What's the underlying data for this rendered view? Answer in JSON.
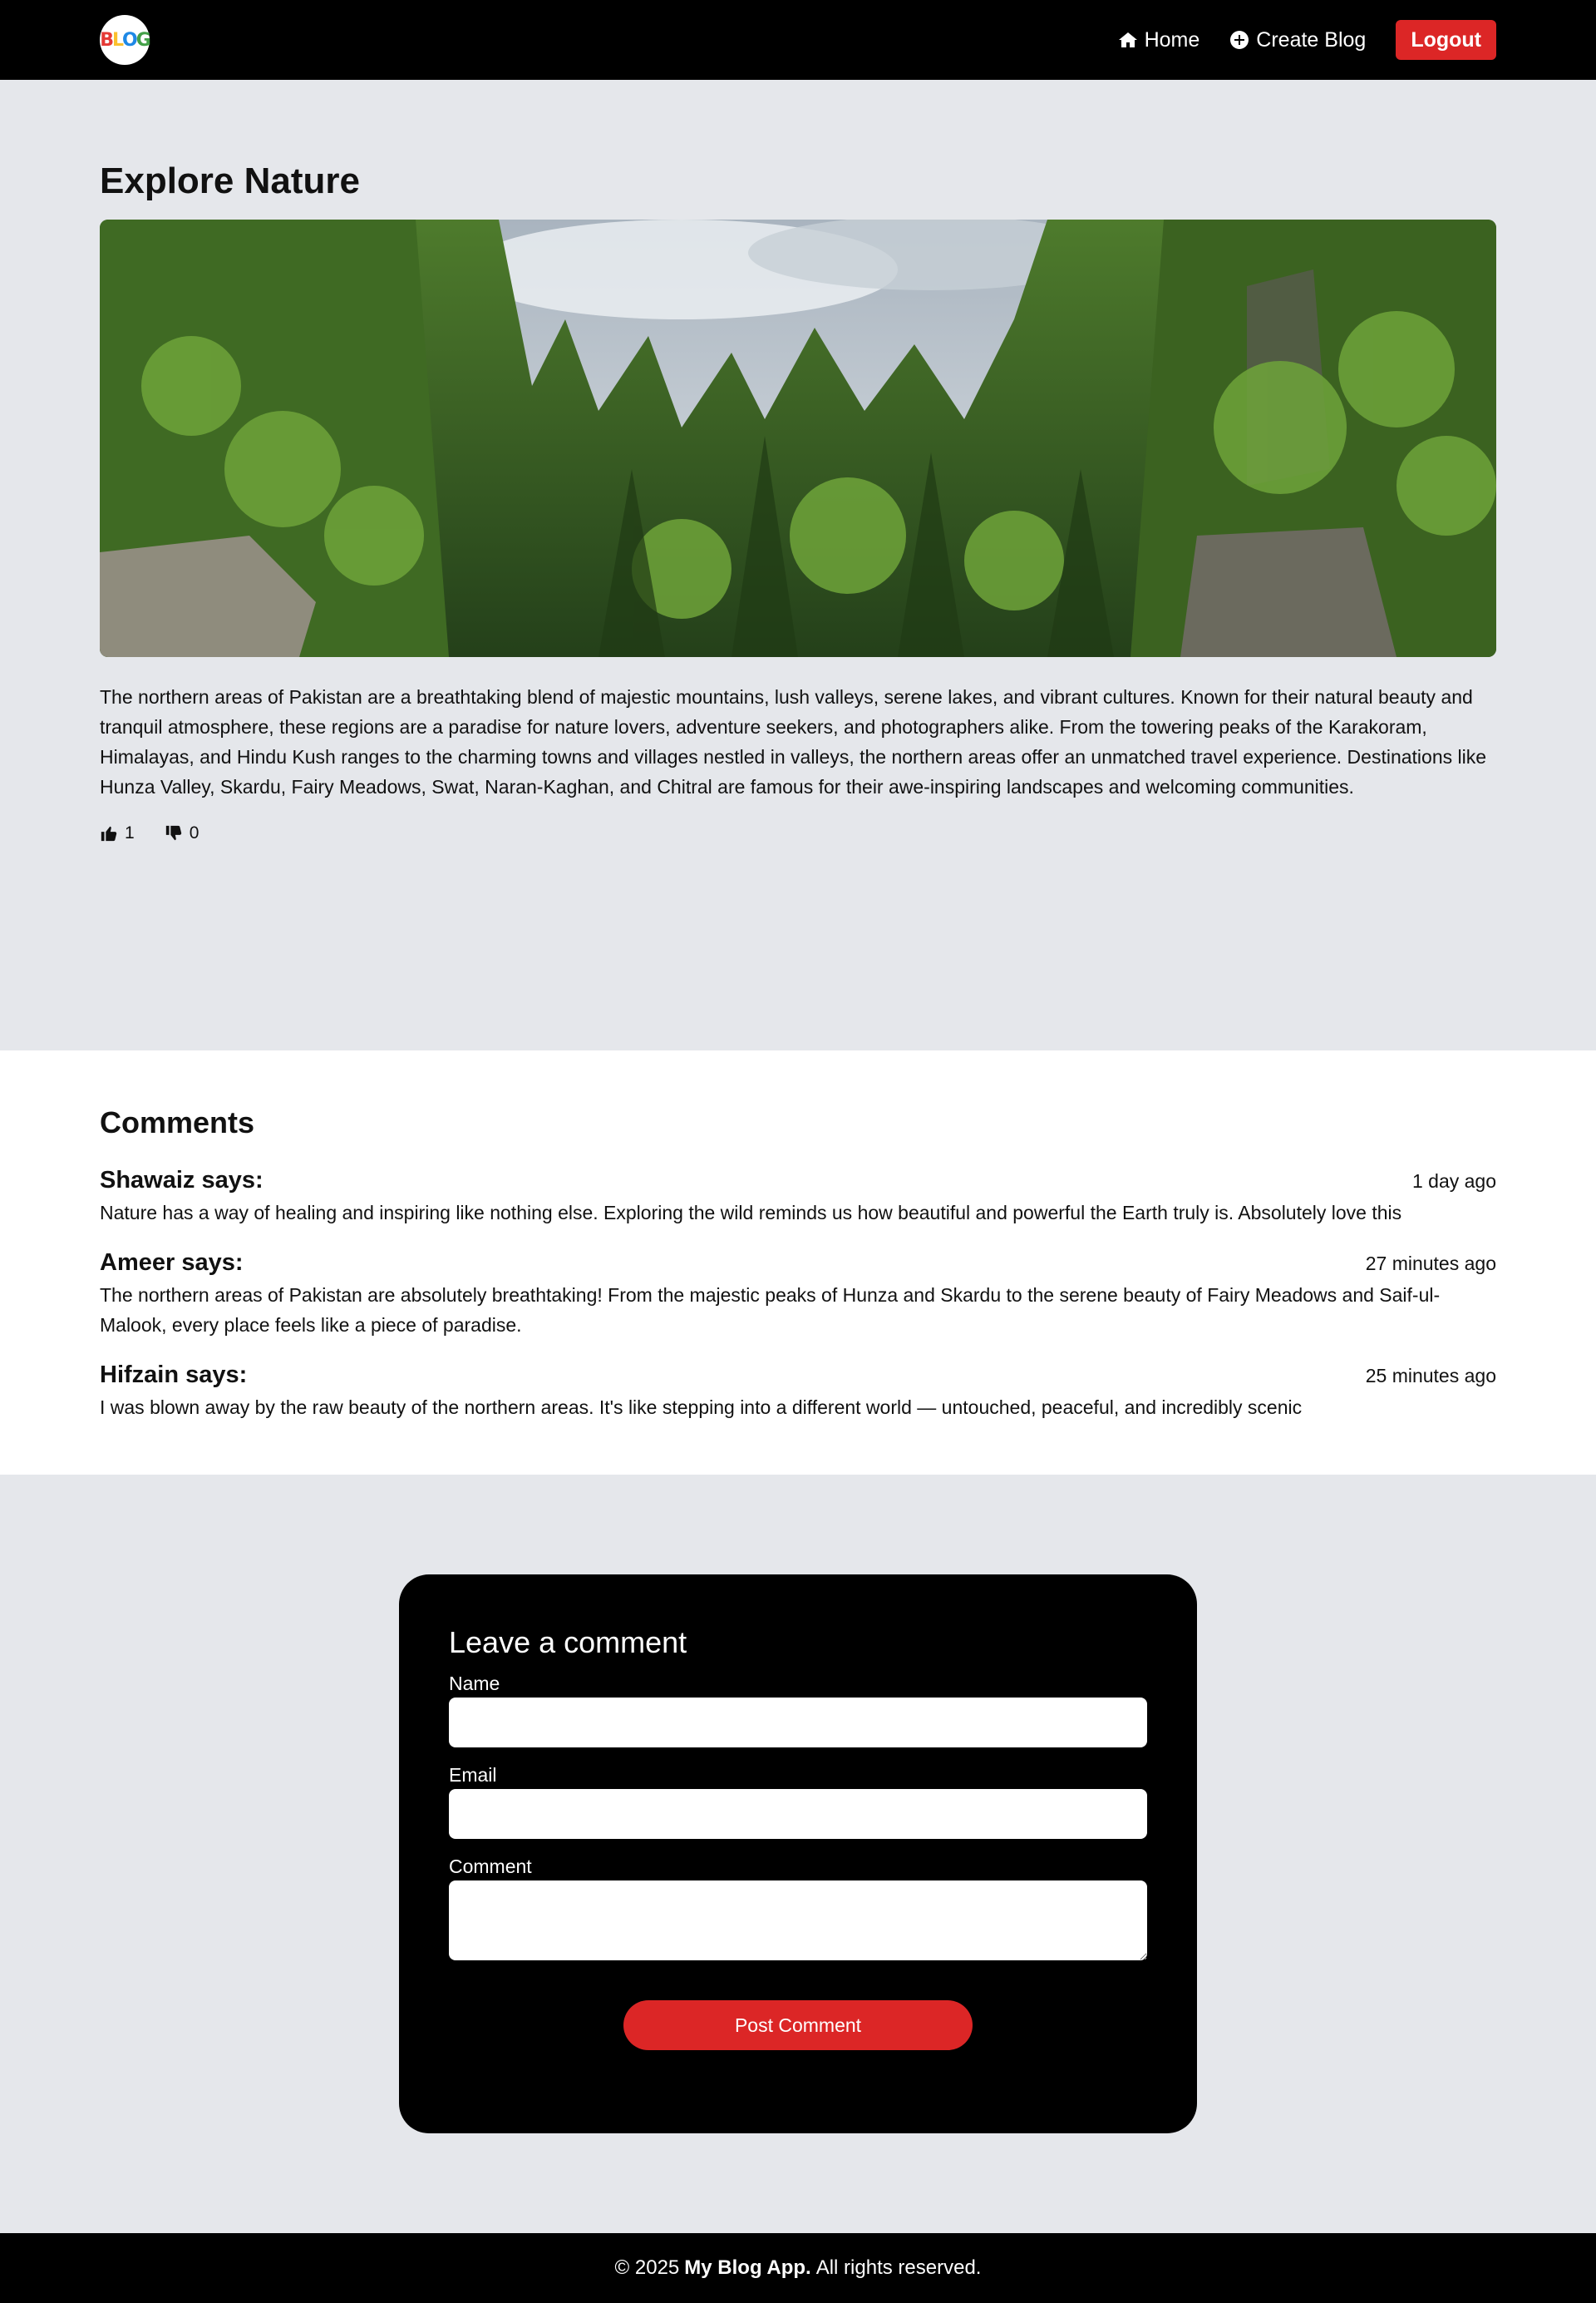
{
  "nav": {
    "logo_text": [
      "B",
      "L",
      "O",
      "G"
    ],
    "home_label": "Home",
    "create_label": "Create Blog",
    "logout_label": "Logout",
    "colors": {
      "background": "#000000",
      "logout": "#dc2626"
    }
  },
  "post": {
    "title": "Explore Nature",
    "image_alt": "forest valley with pine trees",
    "body": "The northern areas of Pakistan are a breathtaking blend of majestic mountains, lush valleys, serene lakes, and vibrant cultures. Known for their natural beauty and tranquil atmosphere, these regions are a paradise for nature lovers, adventure seekers, and photographers alike. From the towering peaks of the Karakoram, Himalayas, and Hindu Kush ranges to the charming towns and villages nestled in valleys, the northern areas offer an unmatched travel experience. Destinations like Hunza Valley, Skardu, Fairy Meadows, Swat, Naran-Kaghan, and Chitral are famous for their awe-inspiring landscapes and welcoming communities.",
    "likes": "1",
    "dislikes": "0"
  },
  "comments": {
    "title": "Comments",
    "items": [
      {
        "author": "Shawaiz says:",
        "time": "1 day ago",
        "text": "Nature has a way of healing and inspiring like nothing else. Exploring the wild reminds us how beautiful and powerful the Earth truly is. Absolutely love this"
      },
      {
        "author": "Ameer says:",
        "time": "27 minutes ago",
        "text": "The northern areas of Pakistan are absolutely breathtaking! From the majestic peaks of Hunza and Skardu to the serene beauty of Fairy Meadows and Saif-ul-Malook, every place feels like a piece of paradise."
      },
      {
        "author": "Hifzain says:",
        "time": "25 minutes ago",
        "text": "I was blown away by the raw beauty of the northern areas. It's like stepping into a different world — untouched, peaceful, and incredibly scenic"
      }
    ]
  },
  "form": {
    "title": "Leave a comment",
    "name_label": "Name",
    "name_value": "",
    "email_label": "Email",
    "email_value": "",
    "comment_label": "Comment",
    "comment_value": "",
    "submit_label": "Post Comment"
  },
  "footer": {
    "prefix": "© 2025",
    "brand": "My Blog App.",
    "suffix": "All rights reserved."
  }
}
